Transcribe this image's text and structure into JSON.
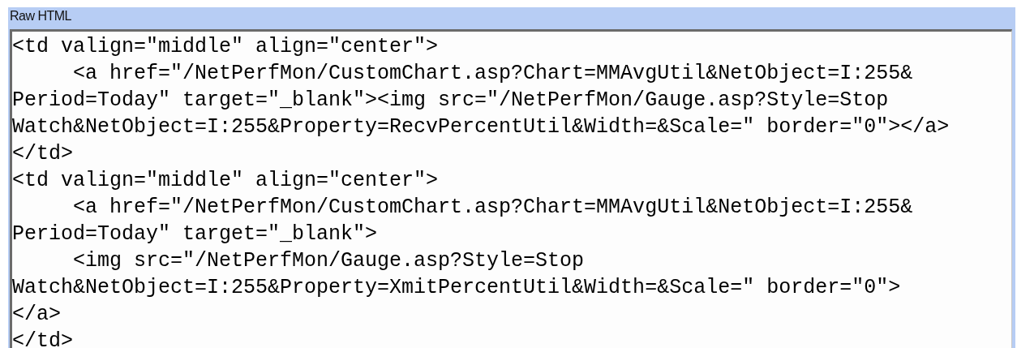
{
  "panel": {
    "title": "Raw HTML",
    "code_lines": [
      "<td valign=\"middle\" align=\"center\">",
      "     <a href=\"/NetPerfMon/CustomChart.asp?Chart=MMAvgUtil&NetObject=I:255&",
      "Period=Today\" target=\"_blank\"><img src=\"/NetPerfMon/Gauge.asp?Style=Stop",
      "Watch&NetObject=I:255&Property=RecvPercentUtil&Width=&Scale=\" border=\"0\"></a>",
      "</td>",
      "<td valign=\"middle\" align=\"center\">",
      "     <a href=\"/NetPerfMon/CustomChart.asp?Chart=MMAvgUtil&NetObject=I:255&",
      "Period=Today\" target=\"_blank\">",
      "     <img src=\"/NetPerfMon/Gauge.asp?Style=Stop",
      "Watch&NetObject=I:255&Property=XmitPercentUtil&Width=&Scale=\" border=\"0\">",
      "</a>",
      "</td>"
    ]
  }
}
